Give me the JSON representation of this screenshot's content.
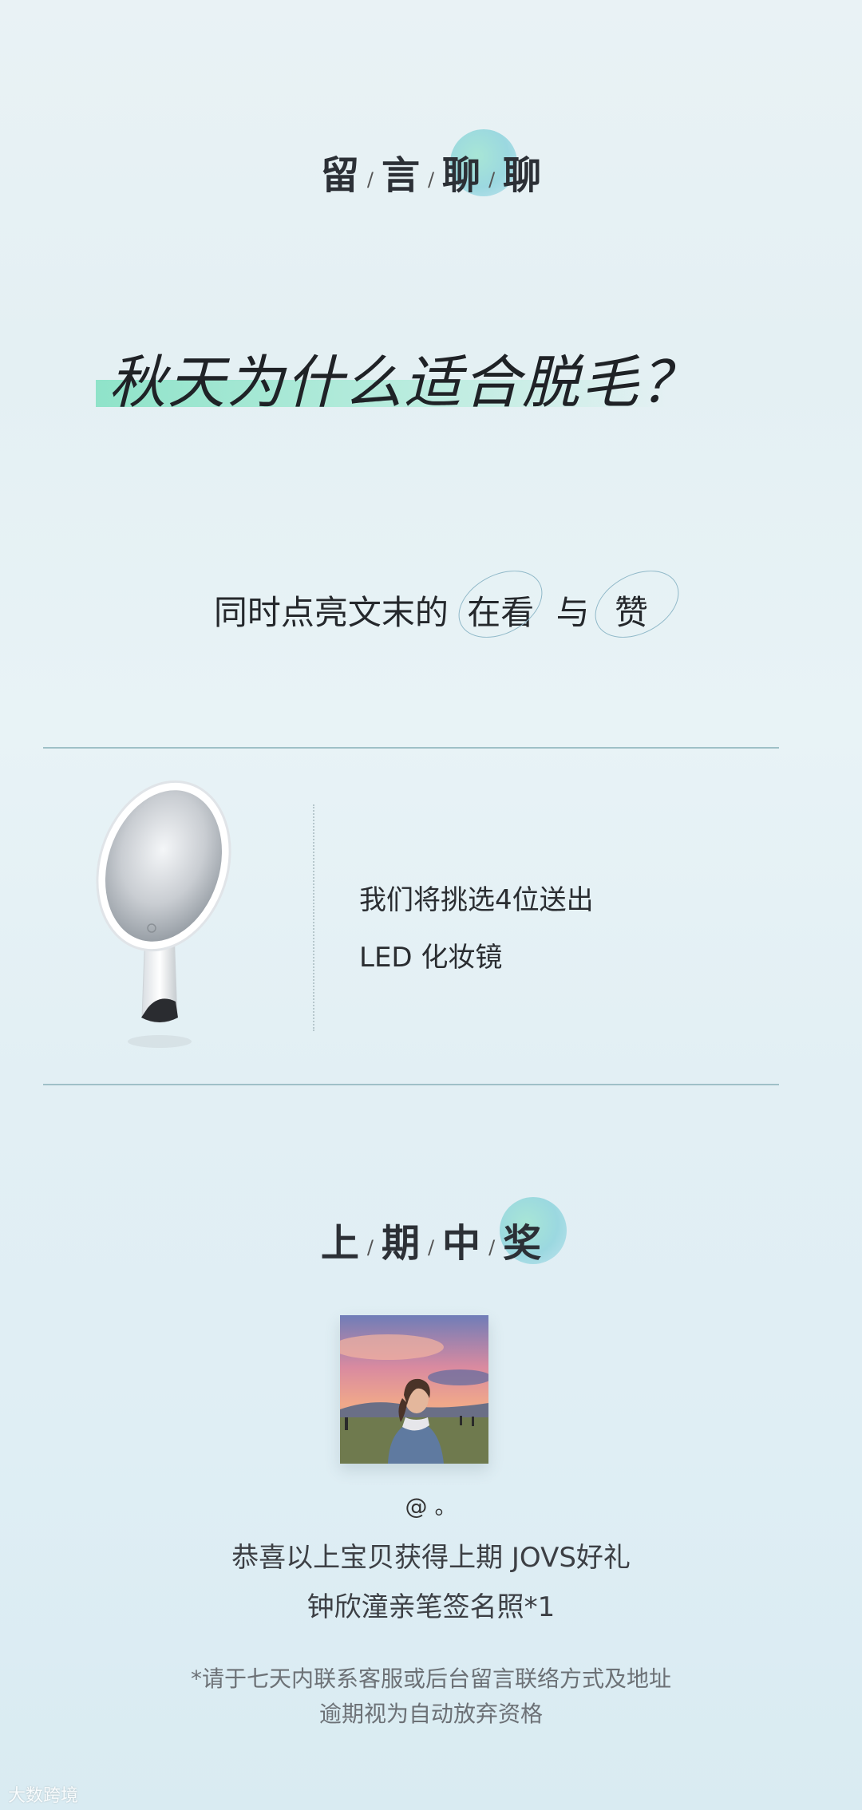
{
  "header": {
    "chars": [
      "留",
      "言",
      "聊",
      "聊"
    ],
    "separator": "/"
  },
  "question": "秋天为什么适合脱毛？",
  "instruction": {
    "prefix": "同时点亮文末的",
    "item1": "在看",
    "joiner": "与",
    "item2": "赞"
  },
  "prize": {
    "line1": "我们将挑选4位送出",
    "line2": "LED 化妆镜",
    "image_icon": "led-makeup-mirror"
  },
  "winners": {
    "chars": [
      "上",
      "期",
      "中",
      "奖"
    ],
    "separator": "/",
    "name": "@ 。",
    "congrats_line1": "恭喜以上宝贝获得上期 JOVS好礼",
    "congrats_line2": "钟欣潼亲笔签名照*1",
    "note_line1": "*请于七天内联系客服或后台留言联络方式及地址",
    "note_line2": "逾期视为自动放弃资格"
  },
  "watermark": "大数跨境",
  "colors": {
    "accent_mint": "#8fe3c9",
    "accent_blob": "#9bd8e0",
    "divider": "#9fc0c7",
    "text_dark": "#2a2d31",
    "text_muted": "#6c7176"
  }
}
